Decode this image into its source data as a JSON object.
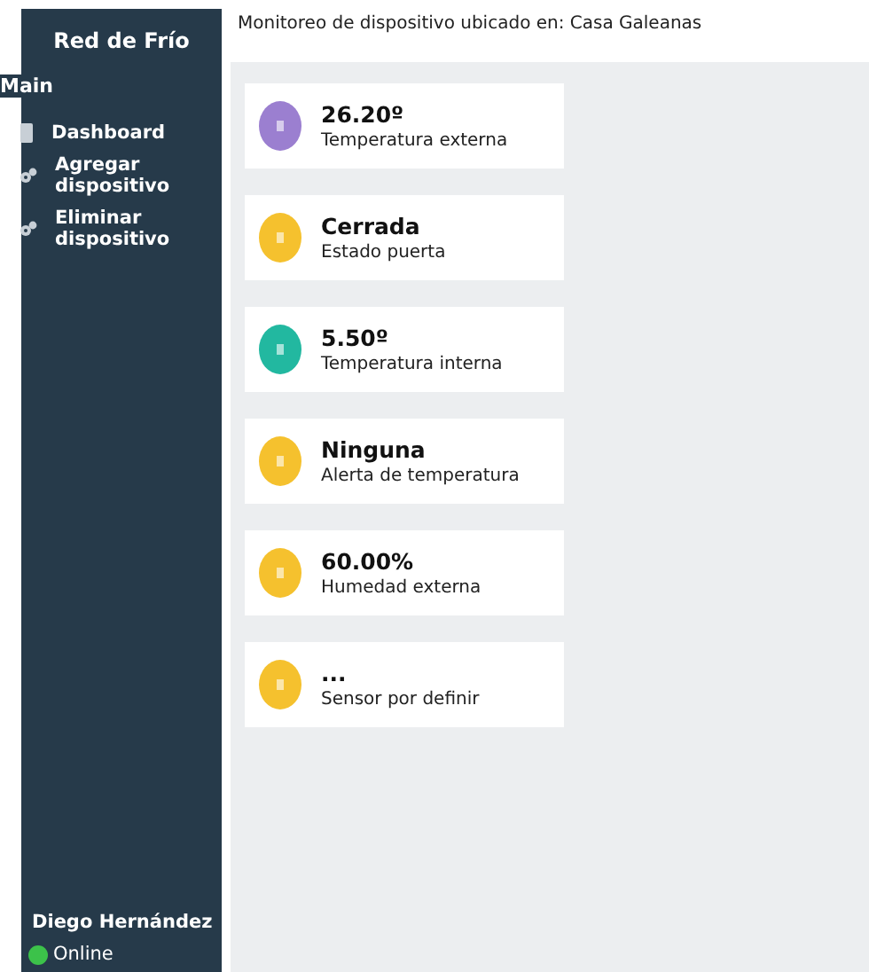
{
  "sidebar": {
    "title": "Red de Frío",
    "section": "Main",
    "items": [
      {
        "label": "Dashboard"
      },
      {
        "label": "Agregar dispositivo"
      },
      {
        "label": "Eliminar dispositivo"
      }
    ],
    "user": {
      "name": "Diego Hernández",
      "status": "Online",
      "online": true
    }
  },
  "header": {
    "title": "Monitoreo de dispositivo ubicado en: Casa Galeanas"
  },
  "cards": [
    {
      "value": "26.20º",
      "label": "Temperatura externa",
      "color": "#9b7fd0"
    },
    {
      "value": "Cerrada",
      "label": "Estado puerta",
      "color": "#f5c12e"
    },
    {
      "value": "5.50º",
      "label": "Temperatura interna",
      "color": "#22b8a0"
    },
    {
      "value": "Ninguna",
      "label": "Alerta de temperatura",
      "color": "#f5c12e"
    },
    {
      "value": "60.00%",
      "label": "Humedad externa",
      "color": "#f5c12e"
    },
    {
      "value": "...",
      "label": "Sensor por definir",
      "color": "#f5c12e"
    }
  ]
}
